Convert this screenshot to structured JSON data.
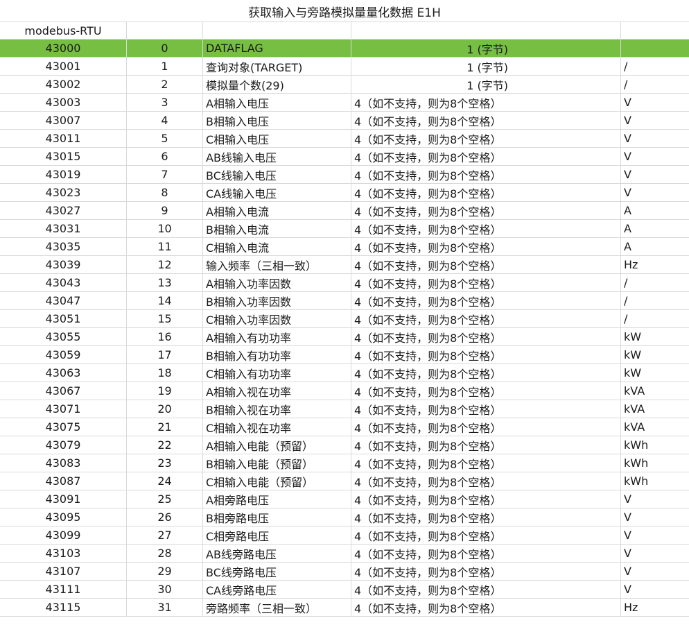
{
  "title": "获取输入与旁路模拟量量化数据 E1H",
  "header_label": "modebus-RTU",
  "highlight_color": "#77bf43",
  "rows": [
    {
      "addr": "43000",
      "idx": "0",
      "name": "DATAFLAG",
      "len": "1 (字节)",
      "unit": "",
      "highlight": true
    },
    {
      "addr": "43001",
      "idx": "1",
      "name": "查询对象(TARGET)",
      "len": "1 (字节)",
      "unit": "/"
    },
    {
      "addr": "43002",
      "idx": "2",
      "name": "模拟量个数(29)",
      "len": "1 (字节)",
      "unit": "/"
    },
    {
      "addr": "43003",
      "idx": "3",
      "name": "A相输入电压",
      "len": "4（如不支持，则为8个空格）",
      "unit": "V"
    },
    {
      "addr": "43007",
      "idx": "4",
      "name": "B相输入电压",
      "len": "4（如不支持，则为8个空格）",
      "unit": "V"
    },
    {
      "addr": "43011",
      "idx": "5",
      "name": "C相输入电压",
      "len": "4（如不支持，则为8个空格）",
      "unit": "V"
    },
    {
      "addr": "43015",
      "idx": "6",
      "name": "AB线输入电压",
      "len": "4（如不支持，则为8个空格）",
      "unit": "V"
    },
    {
      "addr": "43019",
      "idx": "7",
      "name": "BC线输入电压",
      "len": "4（如不支持，则为8个空格）",
      "unit": "V"
    },
    {
      "addr": "43023",
      "idx": "8",
      "name": "CA线输入电压",
      "len": "4（如不支持，则为8个空格）",
      "unit": "V"
    },
    {
      "addr": "43027",
      "idx": "9",
      "name": "A相输入电流",
      "len": "4（如不支持，则为8个空格）",
      "unit": "A"
    },
    {
      "addr": "43031",
      "idx": "10",
      "name": "B相输入电流",
      "len": "4（如不支持，则为8个空格）",
      "unit": "A"
    },
    {
      "addr": "43035",
      "idx": "11",
      "name": "C相输入电流",
      "len": "4（如不支持，则为8个空格）",
      "unit": "A"
    },
    {
      "addr": "43039",
      "idx": "12",
      "name": "输入频率（三相一致）",
      "len": "4（如不支持，则为8个空格）",
      "unit": "Hz"
    },
    {
      "addr": "43043",
      "idx": "13",
      "name": "A相输入功率因数",
      "len": "4（如不支持，则为8个空格）",
      "unit": "/"
    },
    {
      "addr": "43047",
      "idx": "14",
      "name": "B相输入功率因数",
      "len": "4（如不支持，则为8个空格）",
      "unit": "/"
    },
    {
      "addr": "43051",
      "idx": "15",
      "name": "C相输入功率因数",
      "len": "4（如不支持，则为8个空格）",
      "unit": "/"
    },
    {
      "addr": "43055",
      "idx": "16",
      "name": "A相输入有功功率",
      "len": "4（如不支持，则为8个空格）",
      "unit": "kW"
    },
    {
      "addr": "43059",
      "idx": "17",
      "name": "B相输入有功功率",
      "len": "4（如不支持，则为8个空格）",
      "unit": "kW"
    },
    {
      "addr": "43063",
      "idx": "18",
      "name": "C相输入有功功率",
      "len": "4（如不支持，则为8个空格）",
      "unit": "kW"
    },
    {
      "addr": "43067",
      "idx": "19",
      "name": "A相输入视在功率",
      "len": "4（如不支持，则为8个空格）",
      "unit": "kVA"
    },
    {
      "addr": "43071",
      "idx": "20",
      "name": "B相输入视在功率",
      "len": "4（如不支持，则为8个空格）",
      "unit": "kVA"
    },
    {
      "addr": "43075",
      "idx": "21",
      "name": "C相输入视在功率",
      "len": "4（如不支持，则为8个空格）",
      "unit": "kVA"
    },
    {
      "addr": "43079",
      "idx": "22",
      "name": "A相输入电能（预留）",
      "len": "4（如不支持，则为8个空格）",
      "unit": "kWh"
    },
    {
      "addr": "43083",
      "idx": "23",
      "name": "B相输入电能（预留）",
      "len": "4（如不支持，则为8个空格）",
      "unit": "kWh"
    },
    {
      "addr": "43087",
      "idx": "24",
      "name": "C相输入电能（预留）",
      "len": "4（如不支持，则为8个空格）",
      "unit": "kWh"
    },
    {
      "addr": "43091",
      "idx": "25",
      "name": "A相旁路电压",
      "len": "4（如不支持，则为8个空格）",
      "unit": "V"
    },
    {
      "addr": "43095",
      "idx": "26",
      "name": "B相旁路电压",
      "len": "4（如不支持，则为8个空格）",
      "unit": "V"
    },
    {
      "addr": "43099",
      "idx": "27",
      "name": "C相旁路电压",
      "len": "4（如不支持，则为8个空格）",
      "unit": "V"
    },
    {
      "addr": "43103",
      "idx": "28",
      "name": "AB线旁路电压",
      "len": "4（如不支持，则为8个空格）",
      "unit": "V"
    },
    {
      "addr": "43107",
      "idx": "29",
      "name": "BC线旁路电压",
      "len": "4（如不支持，则为8个空格）",
      "unit": "V"
    },
    {
      "addr": "43111",
      "idx": "30",
      "name": "CA线旁路电压",
      "len": "4（如不支持，则为8个空格）",
      "unit": "V"
    },
    {
      "addr": "43115",
      "idx": "31",
      "name": "旁路频率（三相一致）",
      "len": "4（如不支持，则为8个空格）",
      "unit": "Hz"
    }
  ]
}
